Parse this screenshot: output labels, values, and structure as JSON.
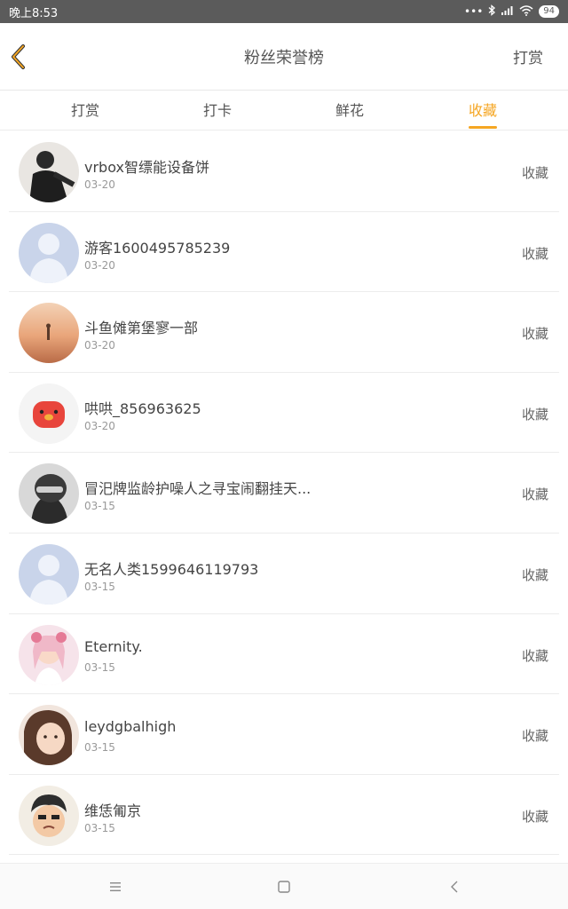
{
  "status_bar": {
    "time": "晚上8:53",
    "icons": [
      "more-dots-icon",
      "bluetooth-icon",
      "signal-icon",
      "wifi-icon"
    ],
    "battery": "94"
  },
  "header": {
    "title": "粉丝荣誉榜",
    "action_label": "打赏"
  },
  "tabs": [
    {
      "label": "打赏",
      "active": false
    },
    {
      "label": "打卡",
      "active": false
    },
    {
      "label": "鲜花",
      "active": false
    },
    {
      "label": "收藏",
      "active": true
    }
  ],
  "colors": {
    "accent": "#f5a623",
    "status_bar_bg": "#5b5b5b",
    "divider": "#ececec"
  },
  "rows": [
    {
      "name": "vrbox智缥能设备饼",
      "date": "03-20",
      "action": "收藏",
      "avatar": "photo-person-avatar"
    },
    {
      "name": "游客1600495785239",
      "date": "03-20",
      "action": "收藏",
      "avatar": "default-avatar"
    },
    {
      "name": "斗鱼傩第堡寥一部",
      "date": "03-20",
      "action": "收藏",
      "avatar": "sunset-photo-avatar"
    },
    {
      "name": "哄哄_856963625",
      "date": "03-20",
      "action": "收藏",
      "avatar": "cartoon-pig-avatar"
    },
    {
      "name": "冒汜牌监龄护噪人之寻宝闹翻挂天...",
      "date": "03-15",
      "action": "收藏",
      "avatar": "helmet-photo-avatar"
    },
    {
      "name": "无名人类1599646119793",
      "date": "03-15",
      "action": "收藏",
      "avatar": "default-avatar"
    },
    {
      "name": "Eternity.",
      "date": "03-15",
      "action": "收藏",
      "avatar": "anime-girl-avatar"
    },
    {
      "name": "leydgbalhigh",
      "date": "03-15",
      "action": "收藏",
      "avatar": "photo-girl-avatar"
    },
    {
      "name": "维恁匍京",
      "date": "03-15",
      "action": "收藏",
      "avatar": "cartoon-baby-avatar"
    }
  ],
  "system_nav": [
    "menu-icon",
    "home-icon",
    "back-icon"
  ]
}
